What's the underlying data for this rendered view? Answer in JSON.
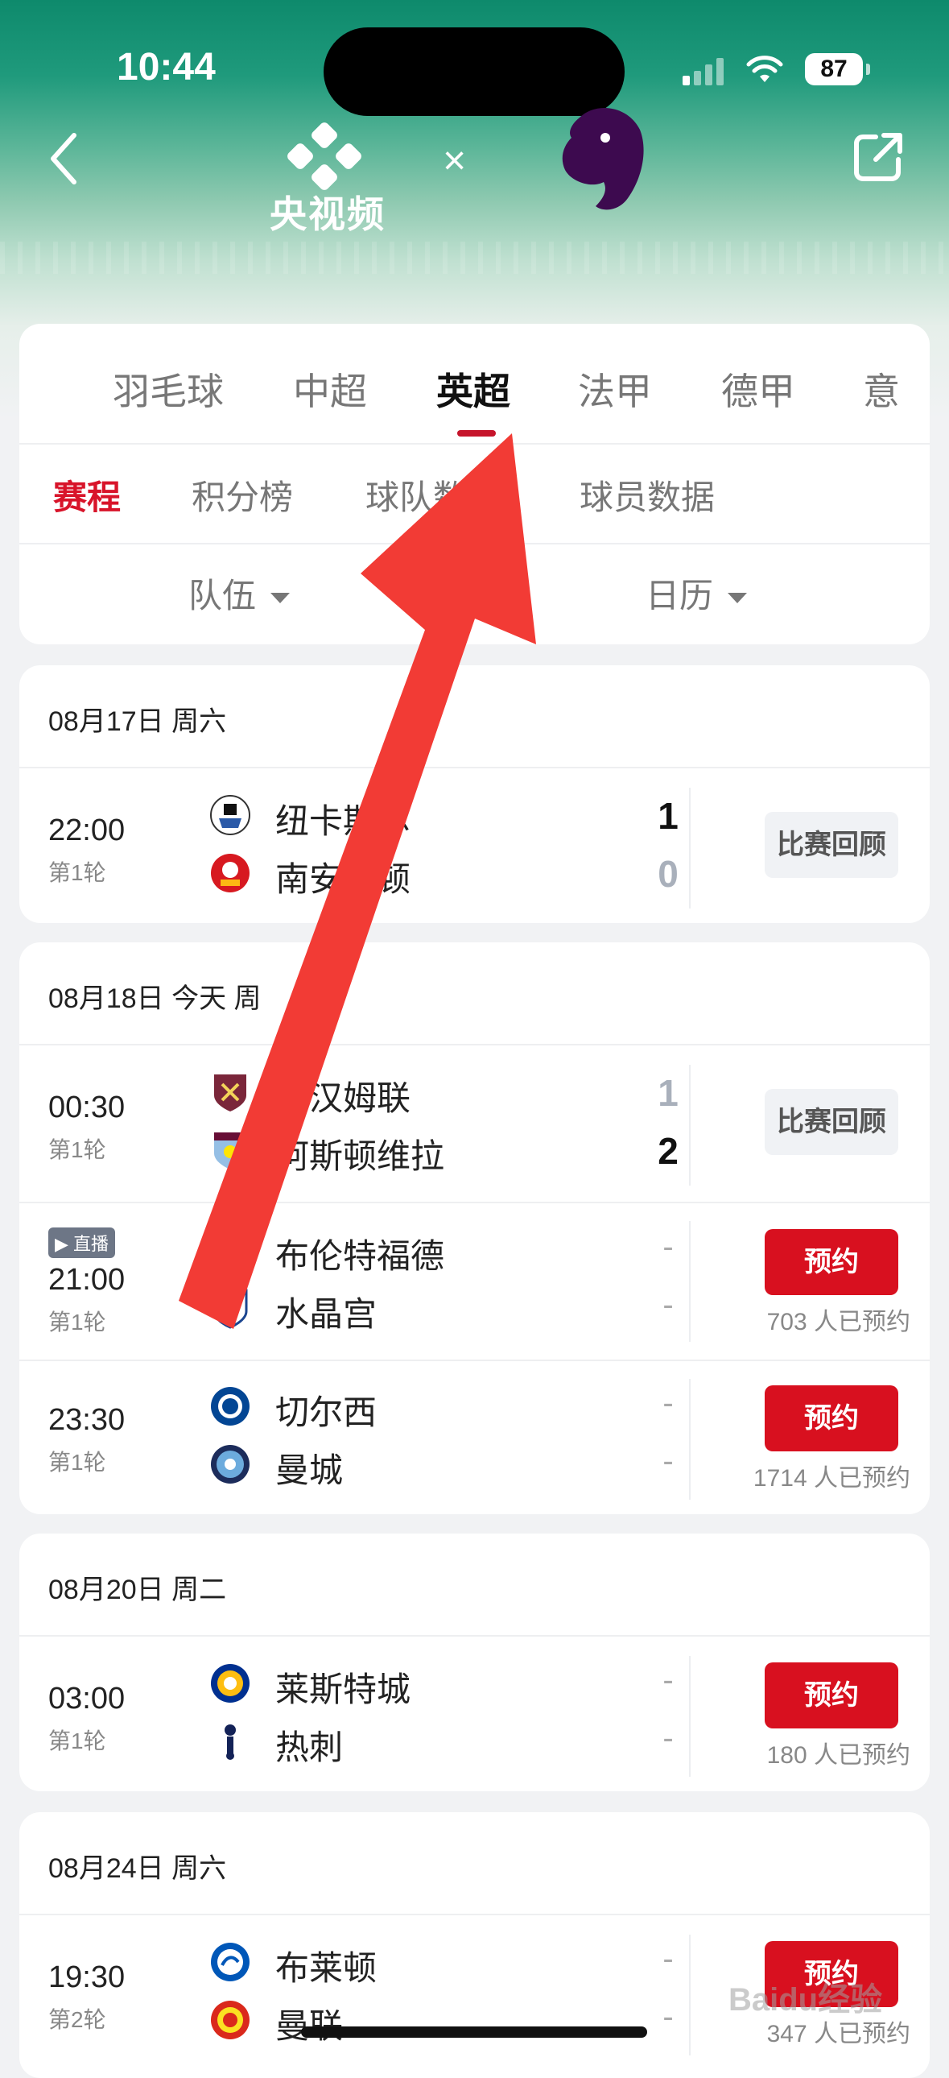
{
  "status_bar": {
    "time": "10:44",
    "battery": "87"
  },
  "header": {
    "brand_text": "央视频",
    "separator": "×"
  },
  "league_tabs": [
    {
      "label": "羽毛球",
      "active": false
    },
    {
      "label": "中超",
      "active": false
    },
    {
      "label": "英超",
      "active": true
    },
    {
      "label": "法甲",
      "active": false
    },
    {
      "label": "德甲",
      "active": false
    },
    {
      "label": "意",
      "active": false
    }
  ],
  "sub_tabs": [
    {
      "label": "赛程",
      "active": true
    },
    {
      "label": "积分榜",
      "active": false
    },
    {
      "label": "球队数",
      "active": false
    },
    {
      "label": "球员数据",
      "active": false
    }
  ],
  "filters": {
    "team": "队伍",
    "calendar": "日历"
  },
  "days": [
    {
      "date": "08月17日 周六",
      "matches": [
        {
          "time": "22:00",
          "round": "第1轮",
          "home": "纽卡斯尔",
          "away": "南安普顿",
          "home_score": "1",
          "away_score": "0",
          "action": "比赛回顾",
          "home_crest": "newcastle-crest-icon",
          "away_crest": "southampton-crest-icon"
        }
      ]
    },
    {
      "date": "08月18日 今天 周",
      "matches": [
        {
          "time": "00:30",
          "round": "第1轮",
          "home": "西汉姆联",
          "away": "阿斯顿维拉",
          "home_score": "1",
          "away_score": "2",
          "action": "比赛回顾",
          "home_crest": "westham-crest-icon",
          "away_crest": "astonvilla-crest-icon"
        },
        {
          "time": "21:00",
          "round": "第1轮",
          "live": "直播",
          "home": "布伦特福德",
          "away": "水晶宫",
          "home_score": "-",
          "away_score": "-",
          "action": "预约",
          "reservations": "703 人已预约",
          "home_crest": "brentford-crest-icon",
          "away_crest": "crystalpalace-crest-icon"
        },
        {
          "time": "23:30",
          "round": "第1轮",
          "home": "切尔西",
          "away": "曼城",
          "home_score": "-",
          "away_score": "-",
          "action": "预约",
          "reservations": "1714 人已预约",
          "home_crest": "chelsea-crest-icon",
          "away_crest": "mancity-crest-icon"
        }
      ]
    },
    {
      "date": "08月20日 周二",
      "matches": [
        {
          "time": "03:00",
          "round": "第1轮",
          "home": "莱斯特城",
          "away": "热刺",
          "home_score": "-",
          "away_score": "-",
          "action": "预约",
          "reservations": "180 人已预约",
          "home_crest": "leicester-crest-icon",
          "away_crest": "tottenham-crest-icon"
        }
      ]
    },
    {
      "date": "08月24日 周六",
      "matches": [
        {
          "time": "19:30",
          "round": "第2轮",
          "home": "布莱顿",
          "away": "曼联",
          "home_score": "-",
          "away_score": "-",
          "action": "预约",
          "reservations": "347 人已预约",
          "home_crest": "brighton-crest-icon",
          "away_crest": "manutd-crest-icon"
        }
      ]
    }
  ],
  "colors": {
    "accent": "#d8142a",
    "reserve_button": "#d8101f",
    "header_green": "#1f9a7c",
    "annotation_arrow": "#f23b35"
  },
  "watermark": "Baidu经验"
}
